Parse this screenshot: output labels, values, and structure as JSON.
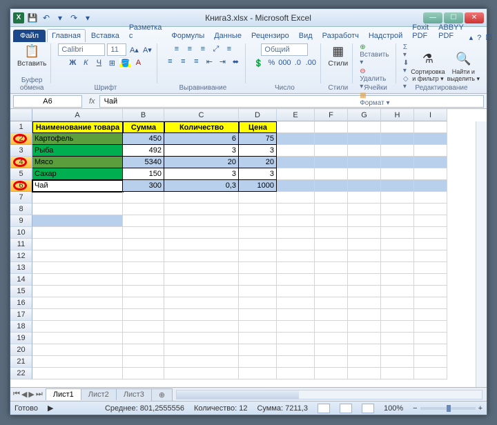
{
  "window": {
    "title": "Книга3.xlsx - Microsoft Excel"
  },
  "qat": {
    "save": "💾",
    "undo": "↶",
    "redo": "↷",
    "dd": "▾"
  },
  "tabs": {
    "file": "Файл",
    "items": [
      "Главная",
      "Вставка",
      "Разметка с",
      "Формулы",
      "Данные",
      "Рецензиро",
      "Вид",
      "Разработч",
      "Надстрой",
      "Foxit PDF",
      "ABBYY PDF"
    ],
    "active": 0,
    "help": "?"
  },
  "ribbon": {
    "clipboard": {
      "paste": "Вставить",
      "label": "Буфер обмена"
    },
    "font": {
      "name": "Calibri",
      "size": "11",
      "label": "Шрифт"
    },
    "align": {
      "label": "Выравнивание",
      "wrap": "≡"
    },
    "number": {
      "format": "Общий",
      "label": "Число"
    },
    "styles": {
      "styles": "Стили",
      "label": "Стили"
    },
    "cells": {
      "insert": "Вставить ▾",
      "delete": "Удалить ▾",
      "format": "Формат ▾",
      "label": "Ячейки"
    },
    "editing": {
      "sum": "Σ ▾",
      "fill": "⬇ ▾",
      "clear": "◇ ▾",
      "sort": "Сортировка\nи фильтр ▾",
      "find": "Найти и\nвыделить ▾",
      "label": "Редактирование"
    }
  },
  "formula_bar": {
    "name_box": "A6",
    "value": "Чай"
  },
  "columns": [
    "A",
    "B",
    "C",
    "D",
    "E",
    "F",
    "G",
    "H",
    "I"
  ],
  "col_widths": {
    "A": 131,
    "B": 60,
    "C": 108,
    "D": 55,
    "E": 55,
    "F": 48,
    "G": 48,
    "H": 48,
    "I": 48
  },
  "headers": [
    "Наименование товара",
    "Сумма",
    "Количество",
    "Цена"
  ],
  "table": [
    {
      "name": "Картофель",
      "sum": "450",
      "qty": "6",
      "price": "75"
    },
    {
      "name": "Рыба",
      "sum": "492",
      "qty": "3",
      "price": "3"
    },
    {
      "name": "Мясо",
      "sum": "5340",
      "qty": "20",
      "price": "20"
    },
    {
      "name": "Сахар",
      "sum": "150",
      "qty": "3",
      "price": "3"
    },
    {
      "name": "Чай",
      "sum": "300",
      "qty": "0,3",
      "price": "1000"
    }
  ],
  "row_count": 22,
  "selected_rows": [
    2,
    4,
    6
  ],
  "active_cell": "A6",
  "circled_rows": [
    2,
    4,
    6
  ],
  "sheets": {
    "active": "Лист1",
    "others": [
      "Лист2",
      "Лист3"
    ]
  },
  "status": {
    "ready": "Готово",
    "avg_label": "Среднее:",
    "avg": "801,2555556",
    "count_label": "Количество:",
    "count": "12",
    "sum_label": "Сумма:",
    "sum": "7211,3",
    "zoom": "100%"
  }
}
